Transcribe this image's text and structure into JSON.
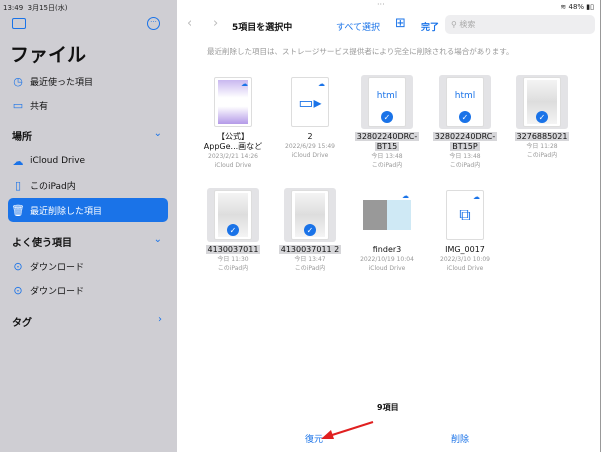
{
  "status": {
    "time": "13:49",
    "date": "3月15日(水)",
    "battery": "48%"
  },
  "sidebar": {
    "title": "ファイル",
    "recents": "最近使った項目",
    "shared": "共有",
    "locations_header": "場所",
    "locations": [
      "iCloud Drive",
      "このiPad内",
      "最近削除した項目"
    ],
    "favorites_header": "よく使う項目",
    "favorites": [
      "ダウンロード",
      "ダウンロード"
    ],
    "tags_header": "タグ"
  },
  "toolbar": {
    "title": "5項目を選択中",
    "select_all": "すべて選択",
    "done": "完了",
    "search_placeholder": "検索"
  },
  "notice": "最近削除した項目は、ストレージサービス提供者により完全に削除される場合があります。",
  "items": [
    {
      "name": "【公式】\nAppGe...画など",
      "date": "2023/2/21 14:26",
      "loc": "iCloud Drive",
      "selected": false
    },
    {
      "name": "2",
      "date": "2022/6/29 15:49",
      "loc": "iCloud Drive",
      "selected": false
    },
    {
      "name": "32802240DRC-\nBT15",
      "date": "今日 13:48",
      "loc": "このiPad内",
      "selected": true,
      "label": "html"
    },
    {
      "name": "32802240DRC-\nBT15P",
      "date": "今日 13:48",
      "loc": "このiPad内",
      "selected": true,
      "label": "html"
    },
    {
      "name": "3276885021",
      "date": "今日 11:28",
      "loc": "このiPad内",
      "selected": true
    },
    {
      "name": "4130037011",
      "date": "今日 11:30",
      "loc": "このiPad内",
      "selected": true
    },
    {
      "name": "4130037011 2",
      "date": "今日 13:47",
      "loc": "このiPad内",
      "selected": true
    },
    {
      "name": "finder3",
      "date": "2022/10/19 10:04",
      "loc": "iCloud Drive",
      "selected": false
    },
    {
      "name": "IMG_0017",
      "date": "2022/3/10 10:09",
      "loc": "iCloud Drive",
      "selected": false
    }
  ],
  "footer": {
    "count": "9項目",
    "recover": "復元",
    "delete": "削除"
  },
  "colors": {
    "accent": "#1a73e8",
    "annotation": "#e02020"
  }
}
